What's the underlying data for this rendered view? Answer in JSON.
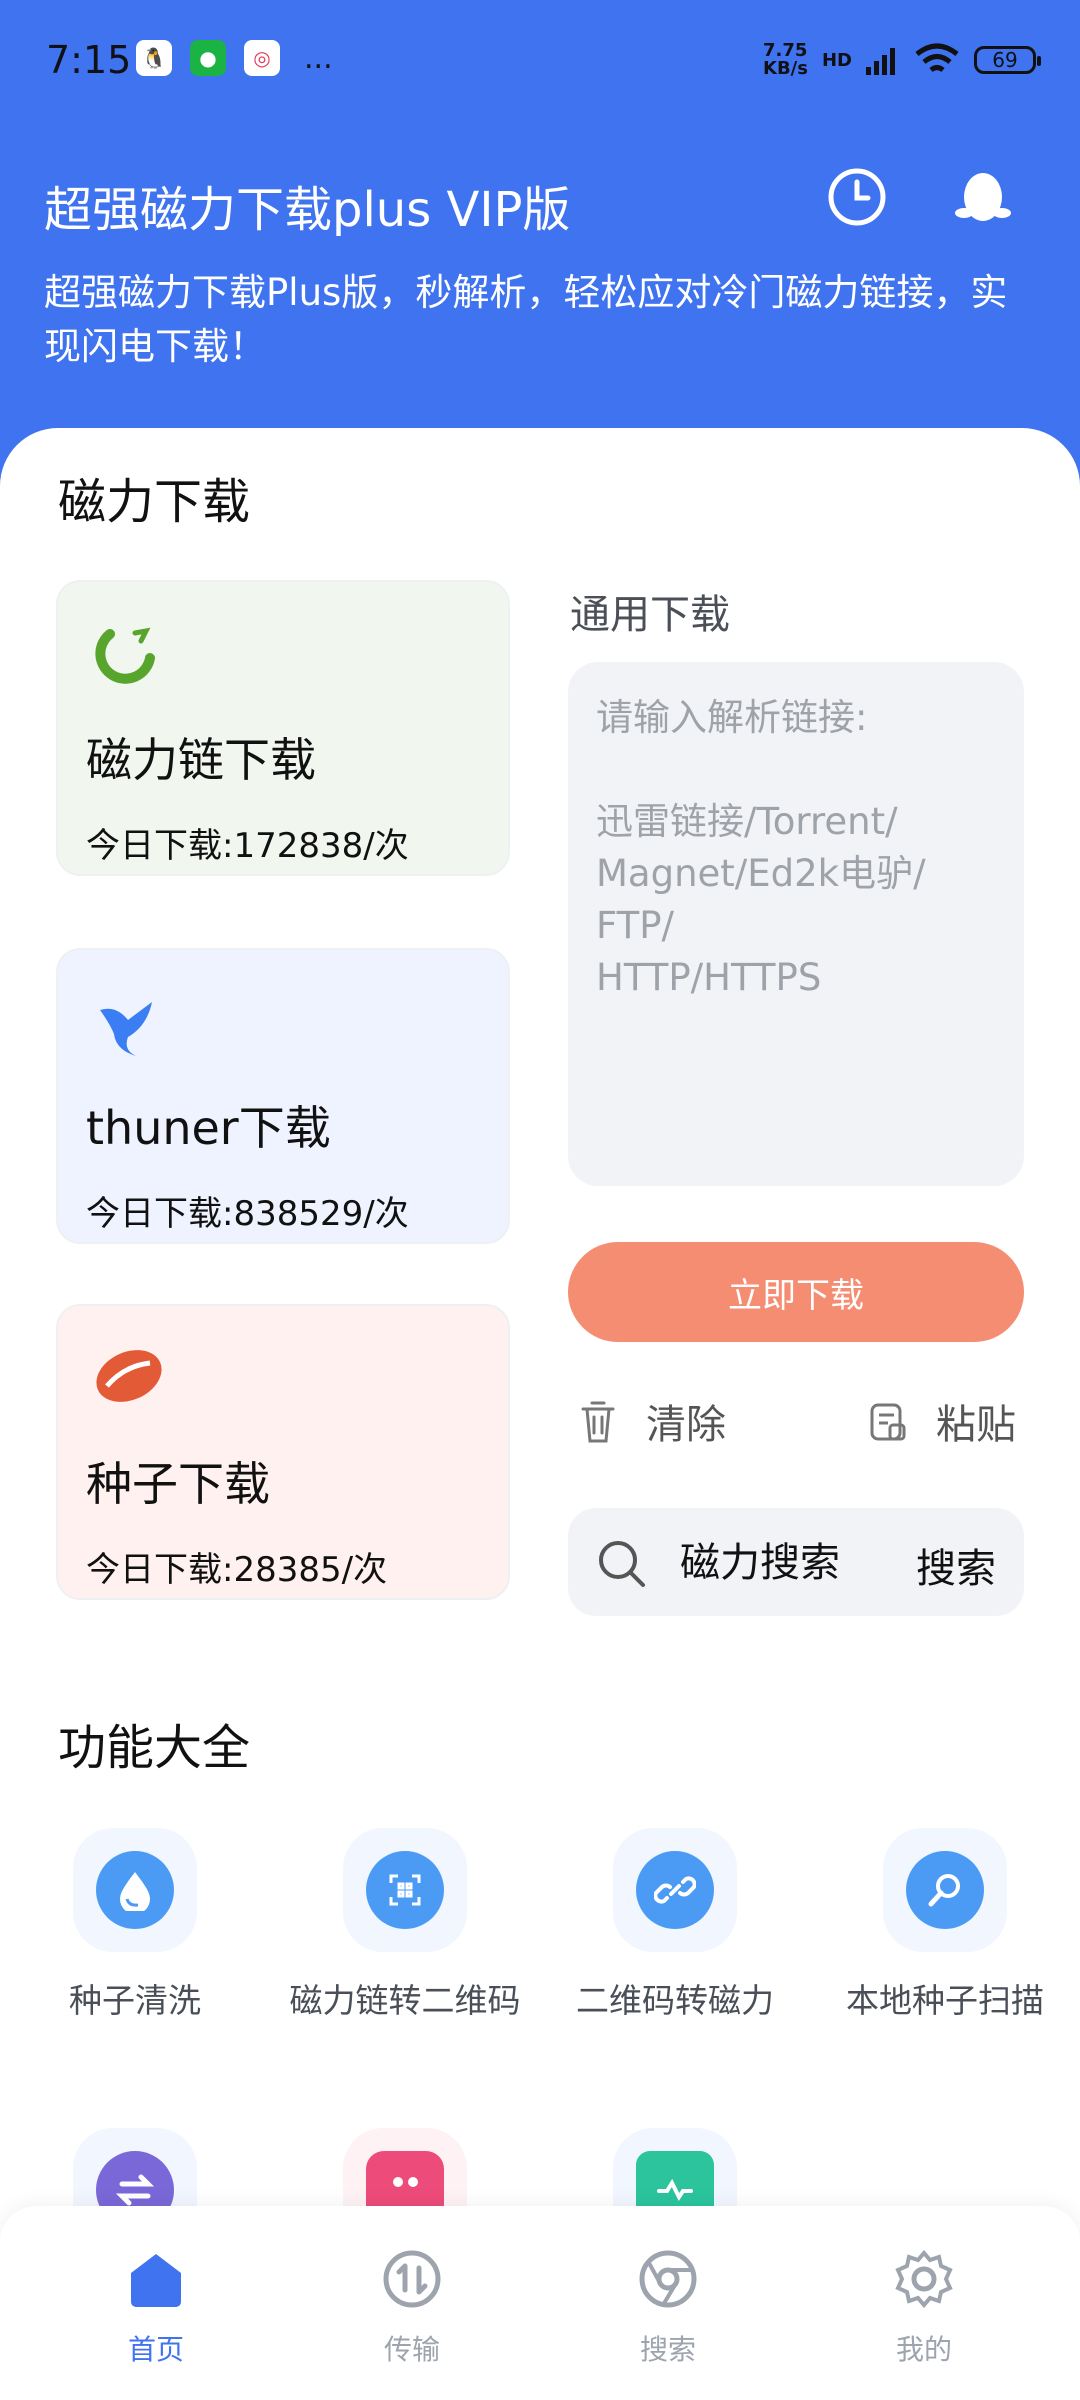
{
  "status_bar": {
    "time": "7:15",
    "network_speed": "7.75\nKB/s",
    "network_type": "HD",
    "battery": "69",
    "apps": [
      "qq-icon",
      "wechat-icon",
      "app-icon"
    ],
    "more": "..."
  },
  "header": {
    "title": "超强磁力下载plus VIP版",
    "subtitle": "超强磁力下载Plus版，秒解析，轻松应对冷门磁力链接，实现闪电下载！"
  },
  "magnet_section": {
    "title": "磁力下载",
    "cards": [
      {
        "title": "磁力链下载",
        "stat": "今日下载:172838/次",
        "icon": "magnet-icon",
        "bg": "#f1f6ef",
        "accent": "#58a52d"
      },
      {
        "title": "thuner下载",
        "stat": "今日下载:838529/次",
        "icon": "bird-icon",
        "bg": "#eef3ff",
        "accent": "#3b7df2"
      },
      {
        "title": "种子下载",
        "stat": "今日下载:28385/次",
        "icon": "seed-icon",
        "bg": "#fff1f0",
        "accent": "#e35a36"
      }
    ]
  },
  "general": {
    "title": "通用下载",
    "placeholder": "请输入解析链接:\n\n迅雷链接/Torrent/\nMagnet/Ed2k电驴/\nFTP/\nHTTP/HTTPS",
    "download_button": "立即下载",
    "clear_label": "清除",
    "paste_label": "粘贴",
    "search_placeholder": "磁力搜索",
    "search_button": "搜索"
  },
  "features_section": {
    "title": "功能大全",
    "items": [
      {
        "label": "种子清洗",
        "icon": "drop-icon"
      },
      {
        "label": "磁力链转二维码",
        "icon": "qr-icon"
      },
      {
        "label": "二维码转磁力",
        "icon": "link-icon"
      },
      {
        "label": "本地种子扫描",
        "icon": "scan-icon"
      }
    ]
  },
  "bottom_nav": [
    {
      "label": "首页",
      "icon": "home-icon",
      "active": true
    },
    {
      "label": "传输",
      "icon": "transfer-icon",
      "active": false
    },
    {
      "label": "搜索",
      "icon": "browser-icon",
      "active": false
    },
    {
      "label": "我的",
      "icon": "settings-icon",
      "active": false
    }
  ],
  "colors": {
    "primary": "#3f73f0",
    "download_button": "#f58d73",
    "highlight": "#89dc1d"
  }
}
